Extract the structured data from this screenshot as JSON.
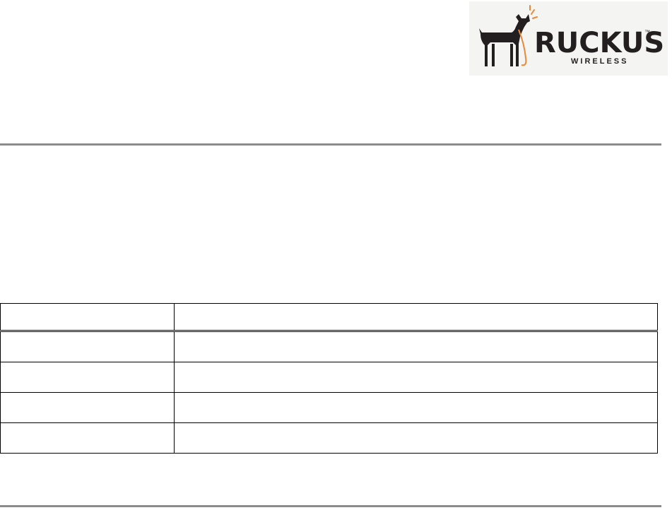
{
  "brand": {
    "wordmark": "RUCKUS",
    "subline": "WIRELESS",
    "trademark": "™",
    "colors": {
      "ink": "#231f20",
      "leash": "#e8893a",
      "logo_bg": "#f4f4f2"
    }
  },
  "rules": {
    "color": "#8c8c8c"
  },
  "table": {
    "header": [
      "",
      ""
    ],
    "rows": [
      [
        "",
        ""
      ],
      [
        "",
        ""
      ],
      [
        "",
        ""
      ],
      [
        "",
        ""
      ]
    ]
  }
}
